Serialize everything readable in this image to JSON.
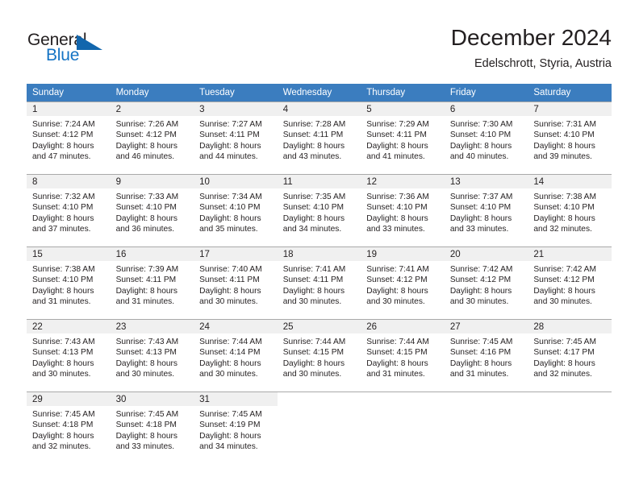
{
  "logo": {
    "word_one": "General",
    "word_two": "Blue",
    "triangle_icon": "triangle-icon",
    "brand_blue": "#1473c4",
    "brand_dark": "#231f20"
  },
  "header": {
    "title": "December 2024",
    "subtitle": "Edelschrott, Styria, Austria"
  },
  "calendar": {
    "header_color": "#3b7dbf",
    "daynum_band_color": "#f0f0f0",
    "weekdays": [
      "Sunday",
      "Monday",
      "Tuesday",
      "Wednesday",
      "Thursday",
      "Friday",
      "Saturday"
    ],
    "weeks": [
      [
        {
          "day": "1",
          "sunrise": "Sunrise: 7:24 AM",
          "sunset": "Sunset: 4:12 PM",
          "daylight_1": "Daylight: 8 hours",
          "daylight_2": "and 47 minutes."
        },
        {
          "day": "2",
          "sunrise": "Sunrise: 7:26 AM",
          "sunset": "Sunset: 4:12 PM",
          "daylight_1": "Daylight: 8 hours",
          "daylight_2": "and 46 minutes."
        },
        {
          "day": "3",
          "sunrise": "Sunrise: 7:27 AM",
          "sunset": "Sunset: 4:11 PM",
          "daylight_1": "Daylight: 8 hours",
          "daylight_2": "and 44 minutes."
        },
        {
          "day": "4",
          "sunrise": "Sunrise: 7:28 AM",
          "sunset": "Sunset: 4:11 PM",
          "daylight_1": "Daylight: 8 hours",
          "daylight_2": "and 43 minutes."
        },
        {
          "day": "5",
          "sunrise": "Sunrise: 7:29 AM",
          "sunset": "Sunset: 4:11 PM",
          "daylight_1": "Daylight: 8 hours",
          "daylight_2": "and 41 minutes."
        },
        {
          "day": "6",
          "sunrise": "Sunrise: 7:30 AM",
          "sunset": "Sunset: 4:10 PM",
          "daylight_1": "Daylight: 8 hours",
          "daylight_2": "and 40 minutes."
        },
        {
          "day": "7",
          "sunrise": "Sunrise: 7:31 AM",
          "sunset": "Sunset: 4:10 PM",
          "daylight_1": "Daylight: 8 hours",
          "daylight_2": "and 39 minutes."
        }
      ],
      [
        {
          "day": "8",
          "sunrise": "Sunrise: 7:32 AM",
          "sunset": "Sunset: 4:10 PM",
          "daylight_1": "Daylight: 8 hours",
          "daylight_2": "and 37 minutes."
        },
        {
          "day": "9",
          "sunrise": "Sunrise: 7:33 AM",
          "sunset": "Sunset: 4:10 PM",
          "daylight_1": "Daylight: 8 hours",
          "daylight_2": "and 36 minutes."
        },
        {
          "day": "10",
          "sunrise": "Sunrise: 7:34 AM",
          "sunset": "Sunset: 4:10 PM",
          "daylight_1": "Daylight: 8 hours",
          "daylight_2": "and 35 minutes."
        },
        {
          "day": "11",
          "sunrise": "Sunrise: 7:35 AM",
          "sunset": "Sunset: 4:10 PM",
          "daylight_1": "Daylight: 8 hours",
          "daylight_2": "and 34 minutes."
        },
        {
          "day": "12",
          "sunrise": "Sunrise: 7:36 AM",
          "sunset": "Sunset: 4:10 PM",
          "daylight_1": "Daylight: 8 hours",
          "daylight_2": "and 33 minutes."
        },
        {
          "day": "13",
          "sunrise": "Sunrise: 7:37 AM",
          "sunset": "Sunset: 4:10 PM",
          "daylight_1": "Daylight: 8 hours",
          "daylight_2": "and 33 minutes."
        },
        {
          "day": "14",
          "sunrise": "Sunrise: 7:38 AM",
          "sunset": "Sunset: 4:10 PM",
          "daylight_1": "Daylight: 8 hours",
          "daylight_2": "and 32 minutes."
        }
      ],
      [
        {
          "day": "15",
          "sunrise": "Sunrise: 7:38 AM",
          "sunset": "Sunset: 4:10 PM",
          "daylight_1": "Daylight: 8 hours",
          "daylight_2": "and 31 minutes."
        },
        {
          "day": "16",
          "sunrise": "Sunrise: 7:39 AM",
          "sunset": "Sunset: 4:11 PM",
          "daylight_1": "Daylight: 8 hours",
          "daylight_2": "and 31 minutes."
        },
        {
          "day": "17",
          "sunrise": "Sunrise: 7:40 AM",
          "sunset": "Sunset: 4:11 PM",
          "daylight_1": "Daylight: 8 hours",
          "daylight_2": "and 30 minutes."
        },
        {
          "day": "18",
          "sunrise": "Sunrise: 7:41 AM",
          "sunset": "Sunset: 4:11 PM",
          "daylight_1": "Daylight: 8 hours",
          "daylight_2": "and 30 minutes."
        },
        {
          "day": "19",
          "sunrise": "Sunrise: 7:41 AM",
          "sunset": "Sunset: 4:12 PM",
          "daylight_1": "Daylight: 8 hours",
          "daylight_2": "and 30 minutes."
        },
        {
          "day": "20",
          "sunrise": "Sunrise: 7:42 AM",
          "sunset": "Sunset: 4:12 PM",
          "daylight_1": "Daylight: 8 hours",
          "daylight_2": "and 30 minutes."
        },
        {
          "day": "21",
          "sunrise": "Sunrise: 7:42 AM",
          "sunset": "Sunset: 4:12 PM",
          "daylight_1": "Daylight: 8 hours",
          "daylight_2": "and 30 minutes."
        }
      ],
      [
        {
          "day": "22",
          "sunrise": "Sunrise: 7:43 AM",
          "sunset": "Sunset: 4:13 PM",
          "daylight_1": "Daylight: 8 hours",
          "daylight_2": "and 30 minutes."
        },
        {
          "day": "23",
          "sunrise": "Sunrise: 7:43 AM",
          "sunset": "Sunset: 4:13 PM",
          "daylight_1": "Daylight: 8 hours",
          "daylight_2": "and 30 minutes."
        },
        {
          "day": "24",
          "sunrise": "Sunrise: 7:44 AM",
          "sunset": "Sunset: 4:14 PM",
          "daylight_1": "Daylight: 8 hours",
          "daylight_2": "and 30 minutes."
        },
        {
          "day": "25",
          "sunrise": "Sunrise: 7:44 AM",
          "sunset": "Sunset: 4:15 PM",
          "daylight_1": "Daylight: 8 hours",
          "daylight_2": "and 30 minutes."
        },
        {
          "day": "26",
          "sunrise": "Sunrise: 7:44 AM",
          "sunset": "Sunset: 4:15 PM",
          "daylight_1": "Daylight: 8 hours",
          "daylight_2": "and 31 minutes."
        },
        {
          "day": "27",
          "sunrise": "Sunrise: 7:45 AM",
          "sunset": "Sunset: 4:16 PM",
          "daylight_1": "Daylight: 8 hours",
          "daylight_2": "and 31 minutes."
        },
        {
          "day": "28",
          "sunrise": "Sunrise: 7:45 AM",
          "sunset": "Sunset: 4:17 PM",
          "daylight_1": "Daylight: 8 hours",
          "daylight_2": "and 32 minutes."
        }
      ],
      [
        {
          "day": "29",
          "sunrise": "Sunrise: 7:45 AM",
          "sunset": "Sunset: 4:18 PM",
          "daylight_1": "Daylight: 8 hours",
          "daylight_2": "and 32 minutes."
        },
        {
          "day": "30",
          "sunrise": "Sunrise: 7:45 AM",
          "sunset": "Sunset: 4:18 PM",
          "daylight_1": "Daylight: 8 hours",
          "daylight_2": "and 33 minutes."
        },
        {
          "day": "31",
          "sunrise": "Sunrise: 7:45 AM",
          "sunset": "Sunset: 4:19 PM",
          "daylight_1": "Daylight: 8 hours",
          "daylight_2": "and 34 minutes."
        },
        {
          "day": "",
          "sunrise": "",
          "sunset": "",
          "daylight_1": "",
          "daylight_2": ""
        },
        {
          "day": "",
          "sunrise": "",
          "sunset": "",
          "daylight_1": "",
          "daylight_2": ""
        },
        {
          "day": "",
          "sunrise": "",
          "sunset": "",
          "daylight_1": "",
          "daylight_2": ""
        },
        {
          "day": "",
          "sunrise": "",
          "sunset": "",
          "daylight_1": "",
          "daylight_2": ""
        }
      ]
    ]
  }
}
